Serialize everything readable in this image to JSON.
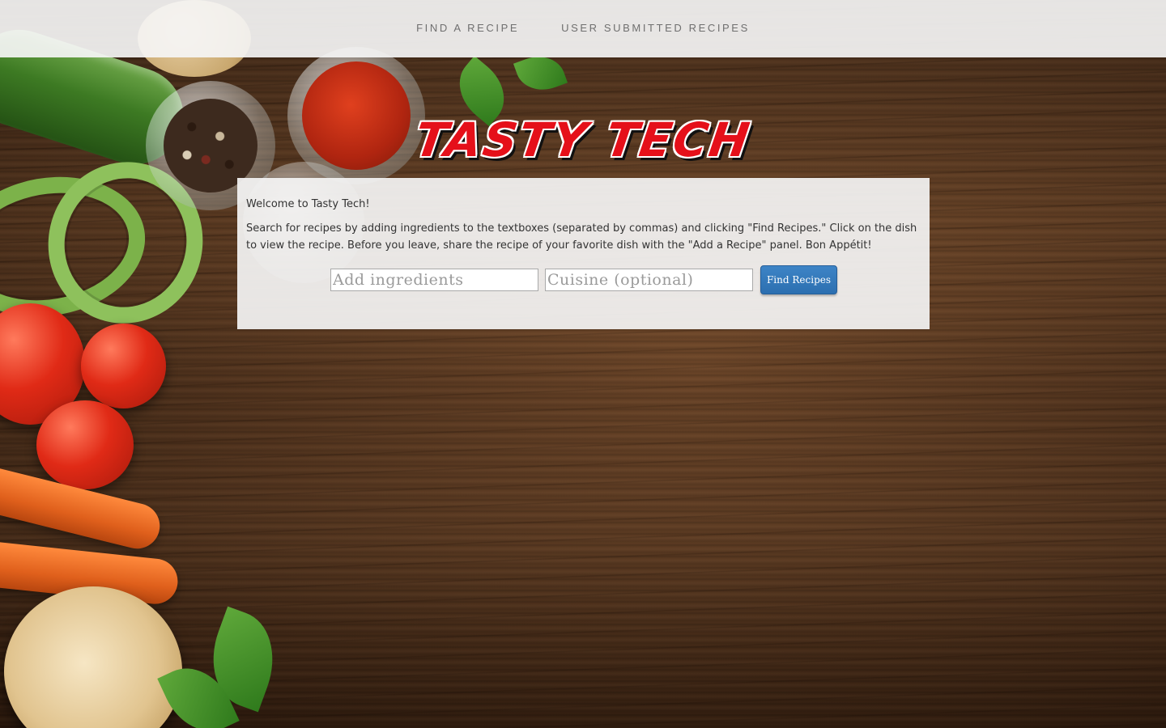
{
  "nav": {
    "items": [
      {
        "label": "FIND A RECIPE"
      },
      {
        "label": "USER SUBMITTED RECIPES"
      }
    ]
  },
  "logo": {
    "text": "TASTY TECH"
  },
  "panel": {
    "welcome": "Welcome to Tasty Tech!",
    "instructions": "Search for recipes by adding ingredients to the textboxes (separated by commas) and clicking \"Find Recipes.\" Click on the dish to view the recipe. Before you leave, share the recipe of your favorite dish with the \"Add a Recipe\" panel. Bon Appétit!"
  },
  "search": {
    "ingredients_placeholder": "Add ingredients",
    "ingredients_value": "",
    "cuisine_placeholder": "Cuisine (optional)",
    "cuisine_value": "",
    "button_label": "Find Recipes"
  },
  "colors": {
    "accent": "#2c6fb0",
    "logo_red": "#e5101a",
    "panel_bg": "#f5f5f5"
  }
}
